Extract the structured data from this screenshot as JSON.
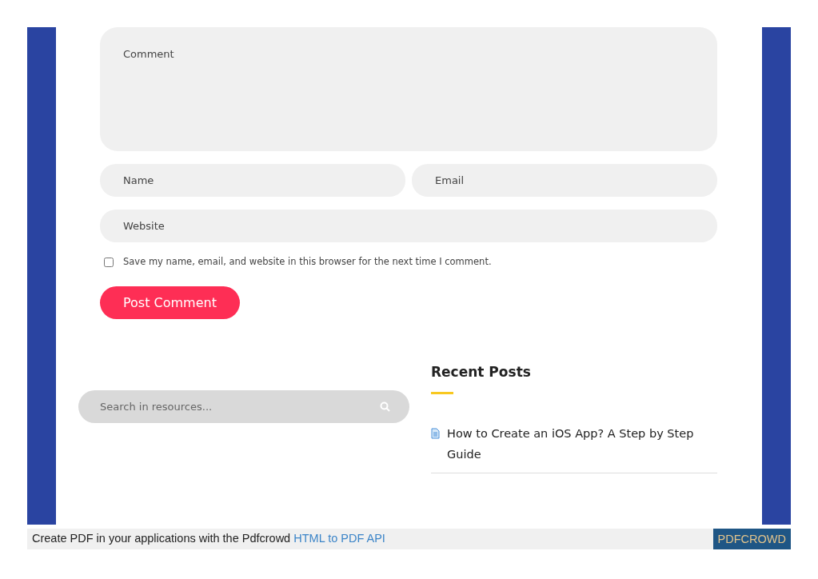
{
  "comment_form": {
    "comment": {
      "placeholder": "Comment"
    },
    "name": {
      "placeholder": "Name"
    },
    "email": {
      "placeholder": "Email"
    },
    "website": {
      "placeholder": "Website"
    },
    "save_consent": {
      "label": "Save my name, email, and website in this browser for the next time I comment.",
      "checked": false
    },
    "submit": "Post Comment"
  },
  "search": {
    "placeholder": "Search in resources..."
  },
  "recent_posts": {
    "title": "Recent Posts",
    "items": [
      {
        "title": "How to Create an iOS App? A Step by Step Guide"
      }
    ]
  },
  "footer": {
    "text": "Create PDF in your applications with the Pdfcrowd ",
    "link": "HTML to PDF API",
    "badge": "PDFCROWD"
  }
}
